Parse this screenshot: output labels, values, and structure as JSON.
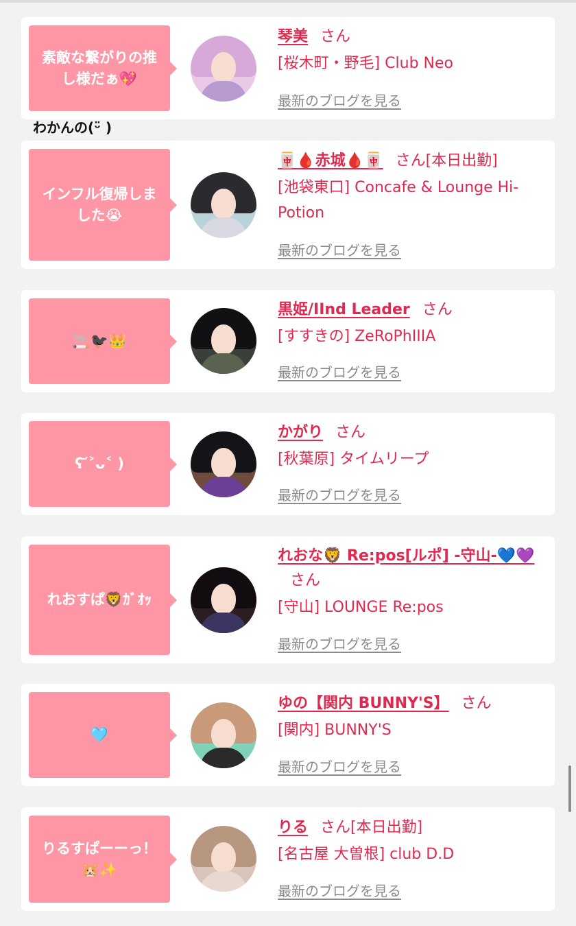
{
  "colors": {
    "accent": "#e0294f",
    "bubble": "#ff96a6",
    "link_gray": "#8a8a8a",
    "background": "#f2f2f2"
  },
  "outside_note": "わかんの(ᵕ̈ )",
  "cards": [
    {
      "bubble": [
        "素敵な繋がりの推",
        "し様だぁ💖"
      ],
      "name": "琴美",
      "san": "さん",
      "status": "",
      "shop": "[桜木町・野毛] Club Neo",
      "blog_link": "最新のブログを見る"
    },
    {
      "bubble": [
        "インフル復帰しま",
        "した😭"
      ],
      "name": "🀄🩸赤城🩸🀄",
      "san": "さん",
      "status": "[本日出勤]",
      "shop": "[池袋東口] Concafe & Lounge Hi-Potion",
      "blog_link": "最新のブログを見る"
    },
    {
      "bubble": [
        "🚬🐦‍⬛👑"
      ],
      "name": "黒姫/IInd Leader",
      "san": "さん",
      "status": "",
      "shop": "[すすきの] ZeRoPhIIIA",
      "blog_link": "最新のブログを見る"
    },
    {
      "bubble": [
        "ʕ ᷄˃ᴗ˂ )"
      ],
      "name": "かがり",
      "san": "さん",
      "status": "",
      "shop": "[秋葉原] タイムリープ",
      "blog_link": "最新のブログを見る"
    },
    {
      "bubble": [
        "れおすぱ🦁ｶﾞｵｯ"
      ],
      "name": "れおな🦁 Re:pos[ルポ] -守山-💙💜",
      "san": "さん",
      "status": "",
      "shop": "[守山] LOUNGE Re:pos",
      "blog_link": "最新のブログを見る"
    },
    {
      "bubble": [
        "🩵"
      ],
      "name": "ゆの【関内 BUNNY'S】",
      "san": "さん",
      "status": "",
      "shop": "[関内] BUNNY'S",
      "blog_link": "最新のブログを見る"
    },
    {
      "bubble": [
        "りるすぱーーっ！",
        "🐹✨"
      ],
      "name": "りる",
      "san": "さん",
      "status": "[本日出勤]",
      "shop": "[名古屋 大曽根] club D.D",
      "blog_link": "最新のブログを見る"
    }
  ]
}
